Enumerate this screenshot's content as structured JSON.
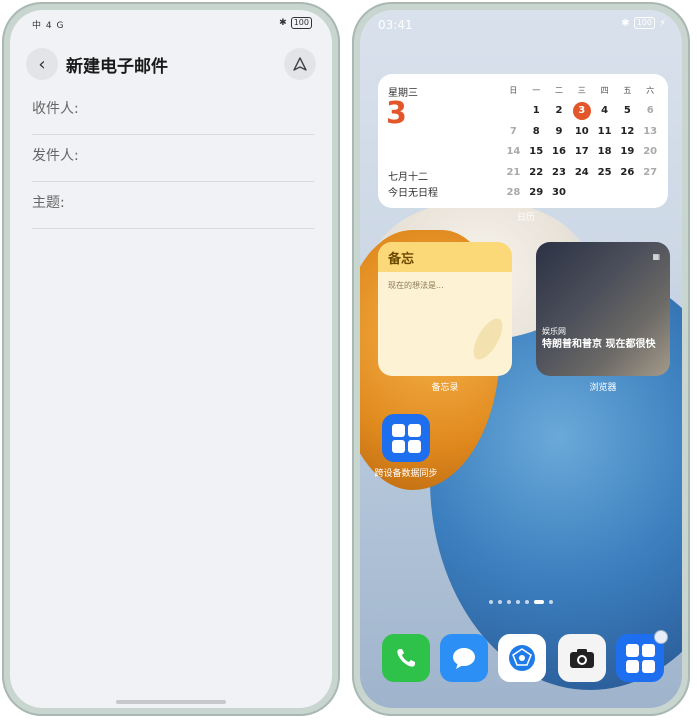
{
  "left_phone": {
    "status_bar": {
      "left": "中 4 G",
      "battery": "100"
    },
    "header": {
      "title": "新建电子邮件"
    },
    "fields": [
      {
        "label": "收件人:"
      },
      {
        "label": "发件人:"
      },
      {
        "label": "主题:"
      }
    ]
  },
  "right_phone": {
    "status_bar": {
      "time": "03:41",
      "battery": "100"
    },
    "calendar": {
      "weekday": "星期三",
      "day": "3",
      "lunar": "七月十二",
      "note": "今日无日程",
      "headers": [
        "日",
        "一",
        "二",
        "三",
        "四",
        "五",
        "六"
      ],
      "rows": [
        [
          "",
          "1",
          "2",
          "3",
          "4",
          "5",
          "6"
        ],
        [
          "7",
          "8",
          "9",
          "10",
          "11",
          "12",
          "13"
        ],
        [
          "14",
          "15",
          "16",
          "17",
          "18",
          "19",
          "20"
        ],
        [
          "21",
          "22",
          "23",
          "24",
          "25",
          "26",
          "27"
        ],
        [
          "28",
          "29",
          "30",
          "",
          "",
          "",
          ""
        ]
      ],
      "label": "日历"
    },
    "memo": {
      "title": "备忘",
      "placeholder": "现在的想法是...",
      "label": "备忘录"
    },
    "browser": {
      "source": "娱乐网",
      "headline": "特朗普和普京 现在都很快",
      "label": "浏览器"
    },
    "sync_app": {
      "label": "跨设备数据同步"
    },
    "dock": [
      "phone-icon",
      "messages-icon",
      "browser-icon",
      "camera-icon",
      "app-grid-icon"
    ]
  }
}
